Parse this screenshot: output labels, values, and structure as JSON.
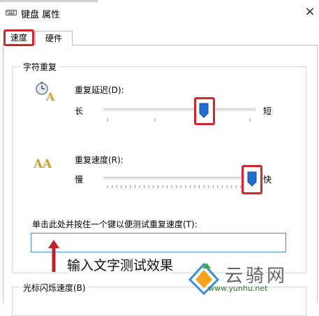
{
  "window": {
    "title": "键盘 属性",
    "close_label": "×"
  },
  "tabs": [
    {
      "label": "速度",
      "active": true
    },
    {
      "label": "硬件",
      "active": false
    }
  ],
  "char_repeat": {
    "group_title": "字符重复",
    "delay": {
      "label": "重复延迟(D):",
      "min_label": "长",
      "max_label": "短",
      "value": 2,
      "max": 3
    },
    "rate": {
      "label": "重复速度(R):",
      "min_label": "慢",
      "max_label": "快",
      "value": 31,
      "max": 31
    },
    "test": {
      "label": "单击此处并按住一个键以便测试重复速度(T):",
      "value": ""
    }
  },
  "cursor_blink": {
    "group_title": "光标闪烁速度(B)"
  },
  "annotation": {
    "text": "输入文字测试效果",
    "color": "#c0202a"
  },
  "watermark": {
    "chars": "云骑网",
    "url": "www.yunhu.net"
  },
  "colors": {
    "highlight": "#d6242e",
    "thumb": "#1e6fd0",
    "input_border": "#4a90d9"
  }
}
